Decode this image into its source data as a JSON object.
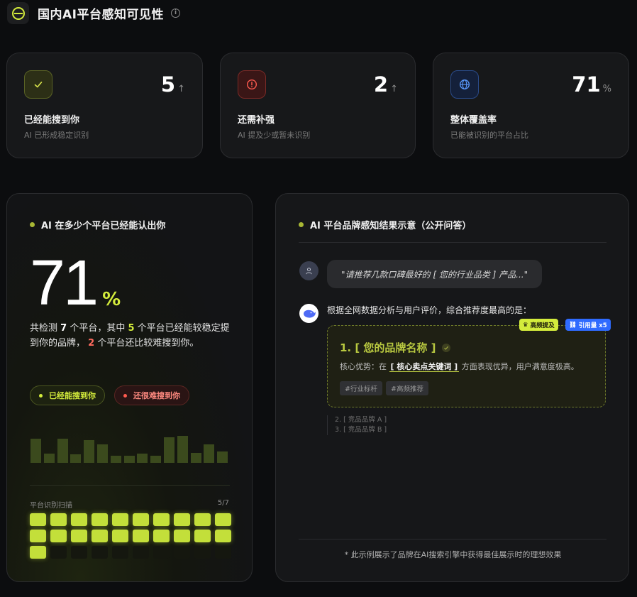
{
  "header": {
    "title": "国内AI平台感知可见性",
    "info_icon": "info-icon",
    "logo_icon": "minus-circle-icon"
  },
  "stats": [
    {
      "value": "5",
      "unit": "↑",
      "label": "已经能搜到你",
      "sub": "AI 已形成稳定识别",
      "icon": "check-icon",
      "accent": "#c8d94a"
    },
    {
      "value": "2",
      "unit": "↑",
      "label": "还需补强",
      "sub": "AI 提及少或暂未识别",
      "icon": "alert-circle-icon",
      "accent": "#ff5a4f"
    },
    {
      "value": "71",
      "unit": "%",
      "label": "整体覆盖率",
      "sub": "已能被识别的平台占比",
      "icon": "globe-icon",
      "accent": "#4a8cff"
    }
  ],
  "left": {
    "title": "AI 在多少个平台已经能认出你",
    "percent": "71",
    "percent_unit": "%",
    "desc": {
      "p1": "共检测 ",
      "total": "7",
      "p2": " 个平台，其中 ",
      "ok": "5",
      "p3": " 个平台已经能较稳定提到你的品牌， ",
      "bad": "2",
      "p4": " 个平台还比较难搜到你。"
    },
    "legend_ok": "已经能搜到你",
    "legend_bad": "还很难搜到你",
    "bars": [
      0.52,
      0.2,
      0.52,
      0.18,
      0.49,
      0.4,
      0.16,
      0.16,
      0.2,
      0.16,
      0.55,
      0.58,
      0.22,
      0.4,
      0.25
    ],
    "scan_label": "平台识别扫描",
    "scan_count": "5/7",
    "scan_cells_on": 21,
    "scan_cells_total": 30
  },
  "right": {
    "title": "AI 平台品牌感知结果示意（公开问答）",
    "question": "\"请推荐几款口碑最好的 [ 您的行业品类 ] 产品...\"",
    "answer": "根据全网数据分析与用户评价，综合推荐度最高的是：",
    "tag_hot": "高频提及",
    "tag_cite": "引用量 x5",
    "result_title": "1. [ 您的品牌名称 ]",
    "core_prefix": "核心优势：在",
    "core_keyword": "[ 核心卖点关键词 ]",
    "core_suffix": "方面表现优异，用户满意度极高。",
    "chips": [
      "#行业标杆",
      "#高频推荐"
    ],
    "others": [
      "2. [ 竞品品牌 A ]",
      "3. [ 竞品品牌 B ]"
    ],
    "footnote": "* 此示例展示了品牌在AI搜索引擎中获得最佳展示时的理想效果"
  },
  "colors": {
    "lime": "#d4ec3c",
    "red": "#ff6b5f",
    "blue": "#2f6bff"
  }
}
